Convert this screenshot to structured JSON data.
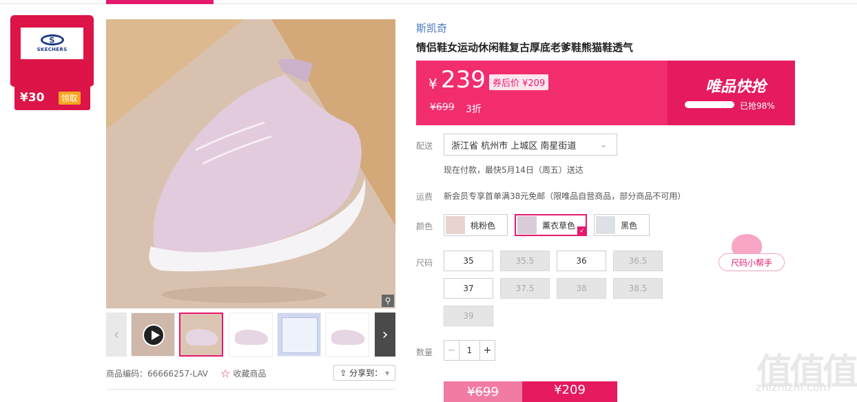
{
  "brand_card": {
    "coupon_amount": "¥30",
    "coupon_button": "领取",
    "logo_text": "SKECHERS"
  },
  "product": {
    "brand": "斯凯奇",
    "title": "情侣鞋女运动休闲鞋复古厚底老爹鞋熊猫鞋透气",
    "price_symbol": "¥",
    "price": "239",
    "after_coupon": "券后价 ¥209",
    "original_price": "¥699",
    "discount": "3折",
    "flash_label": "唯品快抢",
    "sold_text": "已抢98%",
    "sold_fraction": 0.98,
    "code": "商品编码：66666257-LAV",
    "favorite": "收藏商品",
    "share": "分享到："
  },
  "delivery": {
    "label": "配送",
    "address": "浙江省 杭州市 上城区 南星街道",
    "eta": "现在付款，最快5月14日（周五）送达"
  },
  "shipping": {
    "label": "运费",
    "text": "新会员专享首单满38元免邮（限唯品自营商品，部分商品不可用）"
  },
  "colors": {
    "label": "颜色",
    "options": [
      "桃粉色",
      "薰衣草色",
      "黑色"
    ],
    "selected": "薰衣草色"
  },
  "sizes": {
    "label": "尺码",
    "options": [
      "35",
      "35.5",
      "36",
      "36.5",
      "37",
      "37.5",
      "38",
      "38.5",
      "39"
    ],
    "available": [
      "35",
      "36",
      "37"
    ],
    "helper": "尺码小帮手"
  },
  "quantity": {
    "label": "数量",
    "value": "1",
    "minus": "−",
    "plus": "+"
  },
  "buttons": {
    "left": "¥699",
    "right": "¥209"
  },
  "watermark": {
    "logo": "值值值",
    "site": "zhizhizhi.com"
  }
}
